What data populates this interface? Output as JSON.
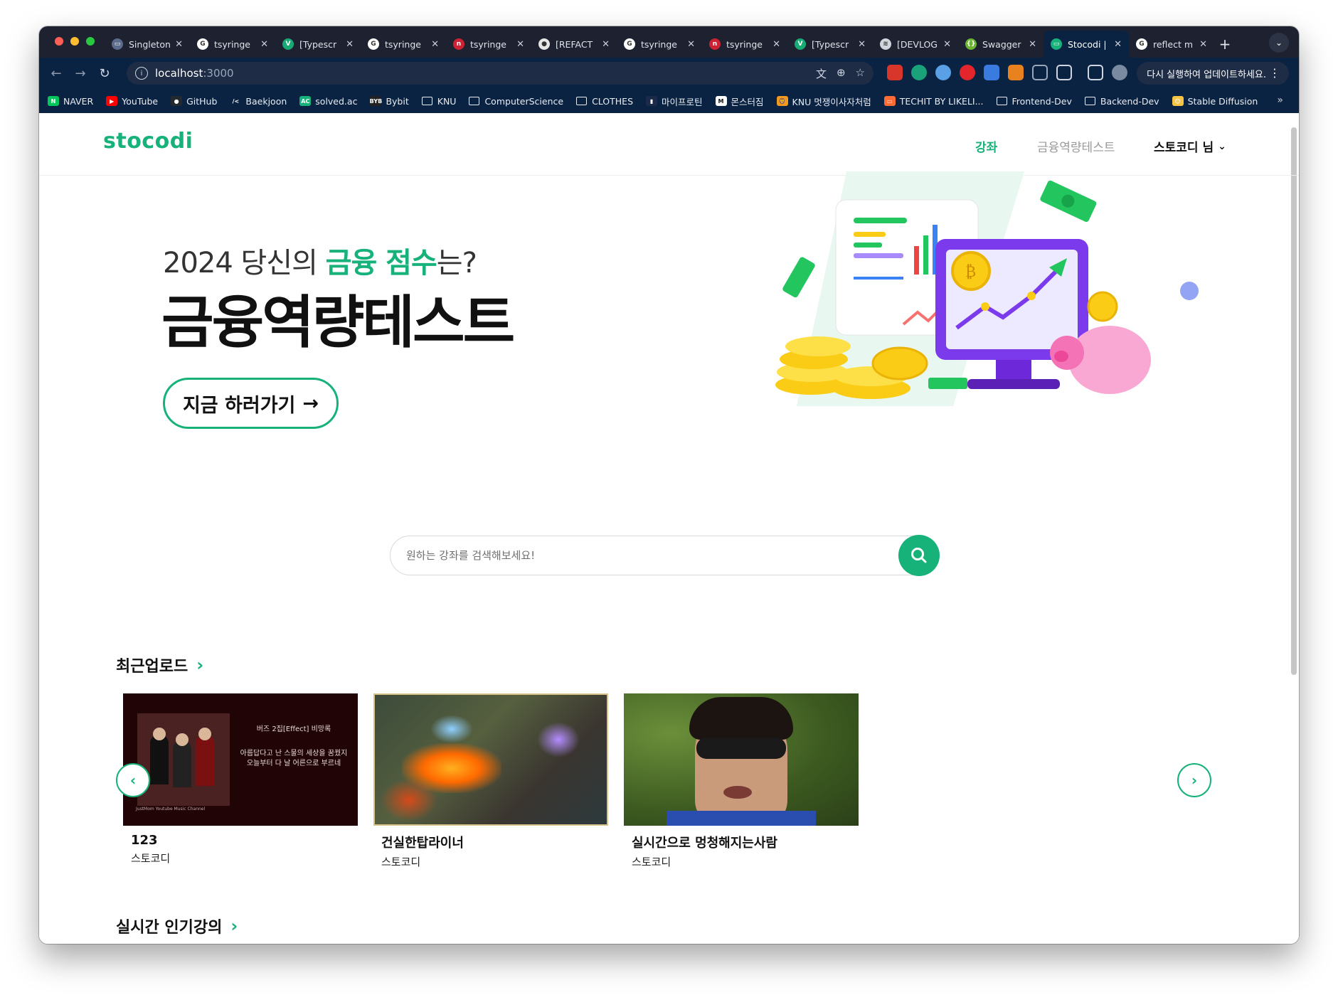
{
  "browser": {
    "tabs": [
      {
        "title": "Singleton",
        "fav_color": "#5b6b8c",
        "fav_text": "▭"
      },
      {
        "title": "tsyringe",
        "fav_color": "#ffffff",
        "fav_text": "G"
      },
      {
        "title": "[Typescr",
        "fav_color": "#19a974",
        "fav_text": "V"
      },
      {
        "title": "tsyringe",
        "fav_color": "#ffffff",
        "fav_text": "G"
      },
      {
        "title": "tsyringe",
        "fav_color": "#cc2233",
        "fav_text": "n"
      },
      {
        "title": "[REFACT",
        "fav_color": "#e6e6e6",
        "fav_text": "●"
      },
      {
        "title": "tsyringe",
        "fav_color": "#ffffff",
        "fav_text": "G"
      },
      {
        "title": "tsyringe",
        "fav_color": "#cc2233",
        "fav_text": "n"
      },
      {
        "title": "[Typescr",
        "fav_color": "#19a974",
        "fav_text": "V"
      },
      {
        "title": "[DEVLOG",
        "fav_color": "#d0d4dc",
        "fav_text": "≋"
      },
      {
        "title": "Swagger",
        "fav_color": "#6bb533",
        "fav_text": "{}"
      },
      {
        "title": "Stocodi |",
        "fav_color": "#17b27a",
        "fav_text": "▭",
        "active": true
      },
      {
        "title": "reflect m",
        "fav_color": "#ffffff",
        "fav_text": "G"
      }
    ],
    "new_tab": "+",
    "url_host": "localhost",
    "url_port": ":3000",
    "update_label": "다시 실행하여 업데이트하세요.",
    "bookmarks": [
      {
        "label": "NAVER",
        "icon": "N",
        "color": "#03c75a"
      },
      {
        "label": "YouTube",
        "icon": "▶",
        "color": "#ff0000"
      },
      {
        "label": "GitHub",
        "icon": "●",
        "color": "#24292e"
      },
      {
        "label": "Baekjoon",
        "icon": "/<",
        "color": "#0b2342"
      },
      {
        "label": "solved.ac",
        "icon": "AC",
        "color": "#17b27a"
      },
      {
        "label": "Bybit",
        "icon": "BYB",
        "color": "#222222"
      },
      {
        "label": "KNU",
        "folder": true
      },
      {
        "label": "ComputerScience",
        "folder": true
      },
      {
        "label": "CLOTHES",
        "folder": true
      },
      {
        "label": "마이프로틴",
        "icon": "▮",
        "color": "#1c2a4a"
      },
      {
        "label": "몬스터짐",
        "icon": "M",
        "color": "#ffffff"
      },
      {
        "label": "KNU 멋쟁이사자처럼",
        "icon": "🦁",
        "color": "#f29a1f"
      },
      {
        "label": "TECHIT BY LIKELI...",
        "icon": "▭",
        "color": "#ff6b35"
      },
      {
        "label": "Frontend-Dev",
        "folder": true
      },
      {
        "label": "Backend-Dev",
        "folder": true
      },
      {
        "label": "Stable Diffusion",
        "icon": "😊",
        "color": "#f6c343"
      }
    ]
  },
  "site": {
    "logo": "stocodi",
    "nav": {
      "course": "강좌",
      "test": "금융역량테스트",
      "user": "스토코디 님"
    },
    "hero": {
      "sub_prefix": "2024 당신의 ",
      "sub_accent": "금융 점수",
      "sub_suffix": "는?",
      "title": "금융역량테스트",
      "button": "지금 하러가기",
      "button_arrow": "→"
    },
    "search": {
      "placeholder": "원하는 강좌를 검색해보세요!"
    },
    "sections": {
      "recent": {
        "title": "최근업로드"
      },
      "popular": {
        "title": "실시간 인기강의"
      }
    },
    "recent_cards": [
      {
        "title": "123",
        "author": "스토코디",
        "thumb_line1": "버즈 2집[Effect] 비망록",
        "thumb_line2": "아름답다고 난 스물의 세상을 꿈꿨지",
        "thumb_line3": "오늘부터 다 날 어른으로 부르네",
        "thumb_credit": "JustMom Youtube Music Channel"
      },
      {
        "title": "건실한탑라이너",
        "author": "스토코디"
      },
      {
        "title": "실시간으로 멍청해지는사람",
        "author": "스토코디"
      }
    ]
  },
  "colors": {
    "brand": "#17b27a",
    "tab_bg": "#1d2130",
    "toolbar_bg": "#0b2342"
  }
}
